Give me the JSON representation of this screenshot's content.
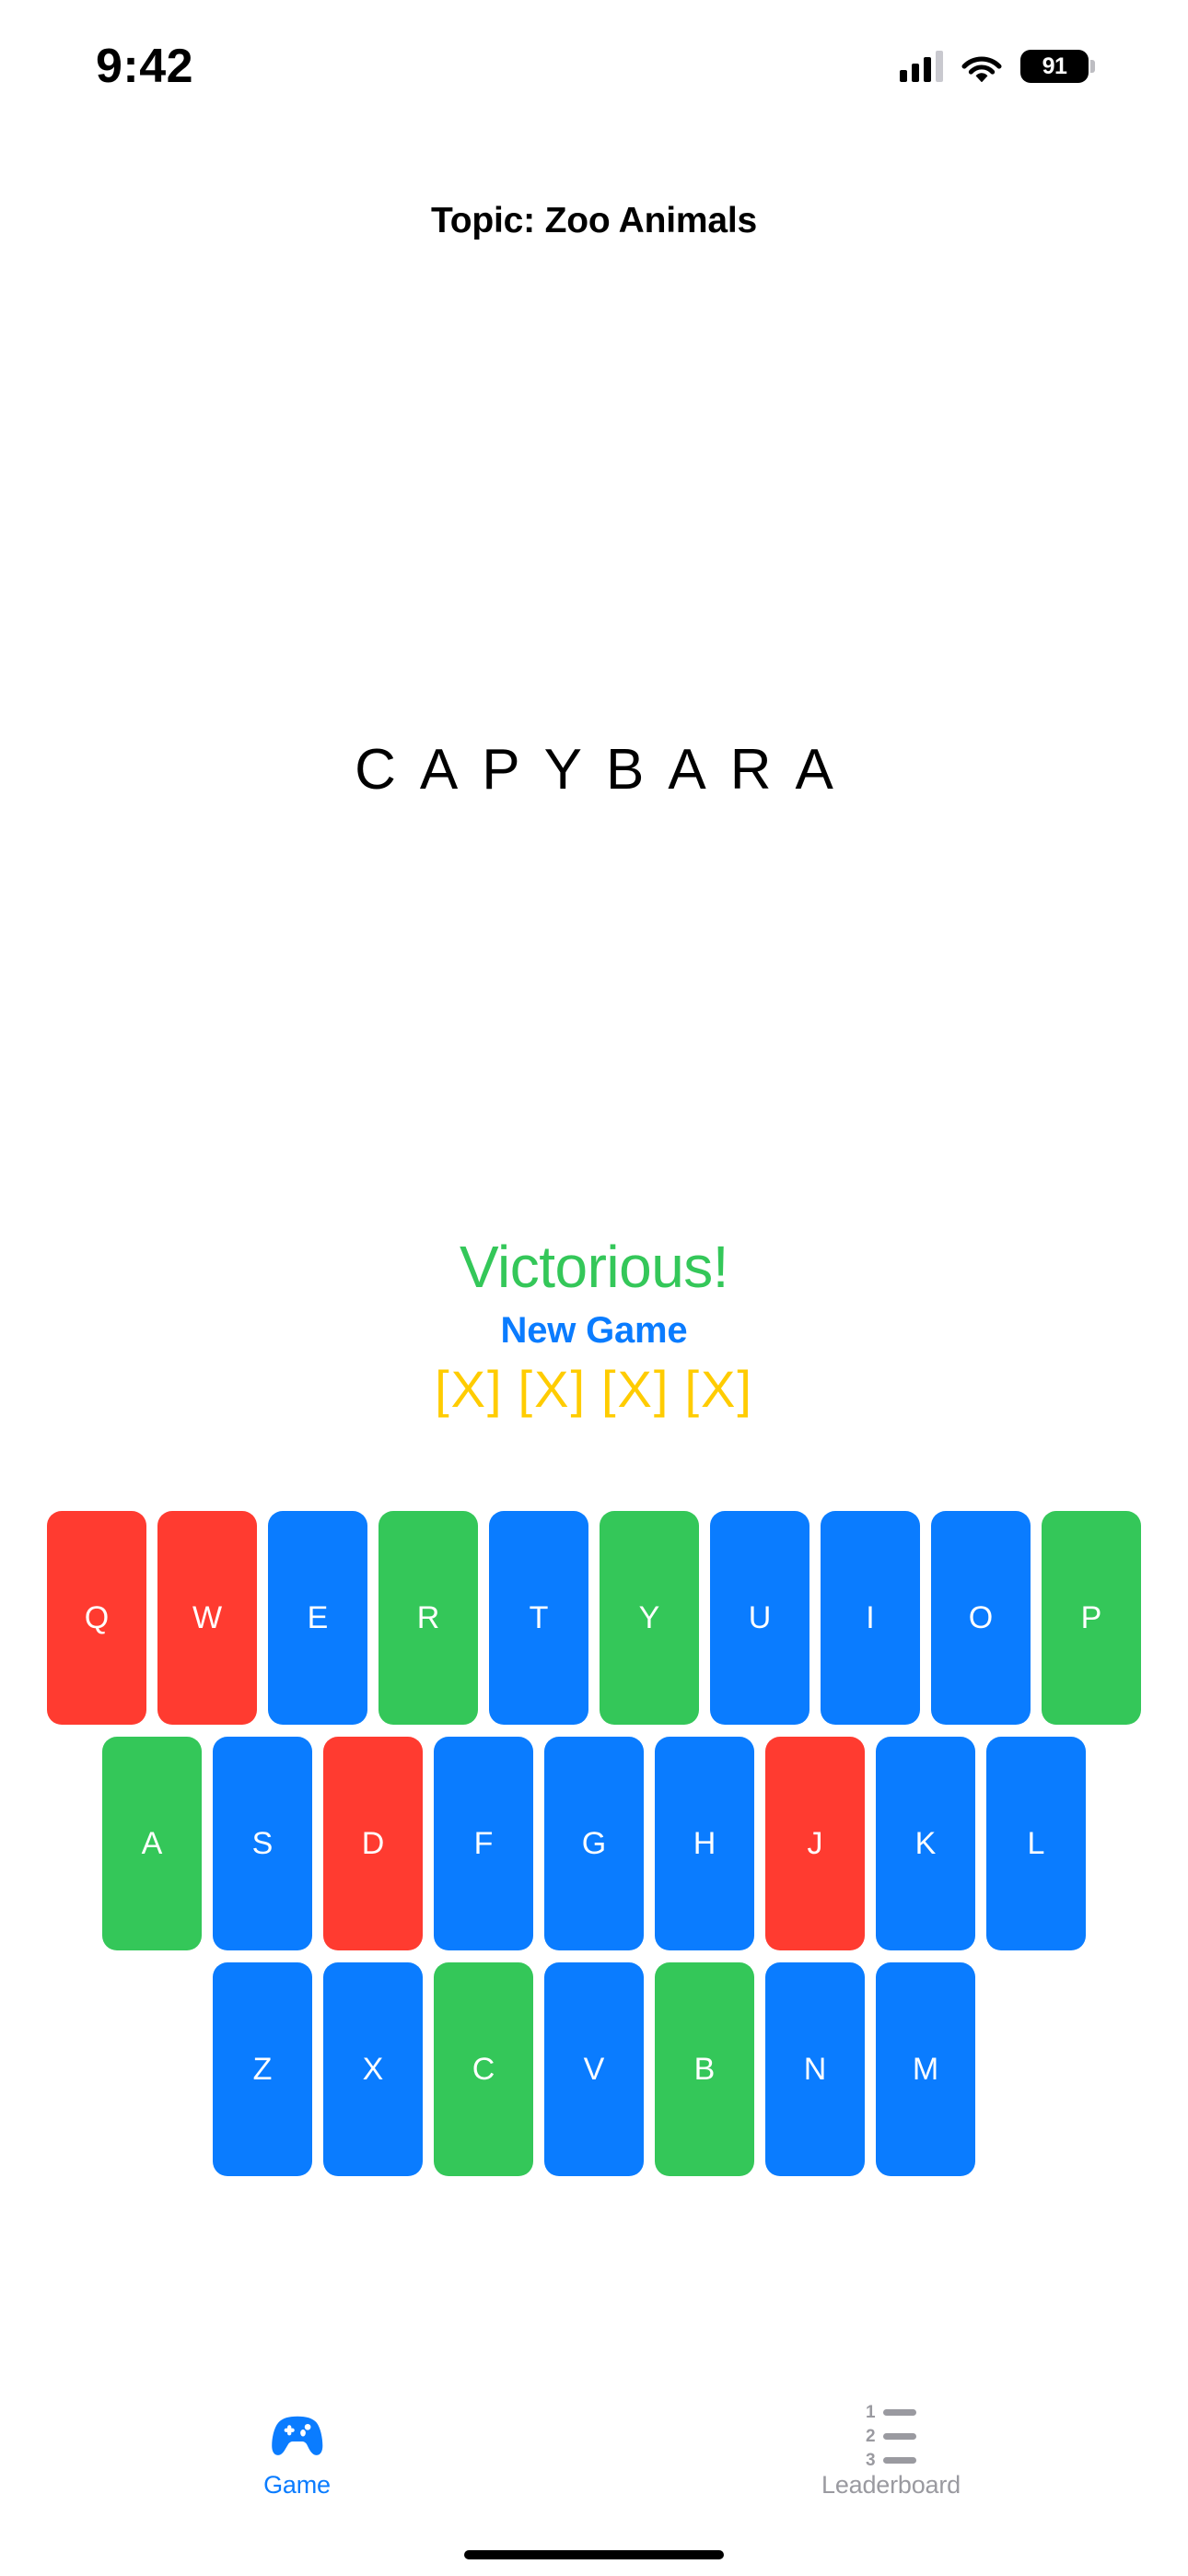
{
  "status_bar": {
    "time": "9:42",
    "cellular_icon": "cellular-signal-icon",
    "wifi_icon": "wifi-icon",
    "battery_icon": "battery-icon",
    "battery_level": "91"
  },
  "header": {
    "topic_label": "Topic: Zoo Animals"
  },
  "game": {
    "secret_word": "CAPYBARA",
    "status_text": "Victorious!",
    "status_color": "#34c759",
    "new_game_label": "New Game",
    "lives_remaining": 4,
    "life_glyph": "[X]",
    "life_color": "#ffcc00"
  },
  "keyboard": {
    "colors": {
      "unused": "#0a7cff",
      "correct": "#34c759",
      "wrong": "#ff3b30"
    },
    "rows": [
      [
        {
          "letter": "Q",
          "state": "wrong"
        },
        {
          "letter": "W",
          "state": "wrong"
        },
        {
          "letter": "E",
          "state": "unused"
        },
        {
          "letter": "R",
          "state": "correct"
        },
        {
          "letter": "T",
          "state": "unused"
        },
        {
          "letter": "Y",
          "state": "correct"
        },
        {
          "letter": "U",
          "state": "unused"
        },
        {
          "letter": "I",
          "state": "unused"
        },
        {
          "letter": "O",
          "state": "unused"
        },
        {
          "letter": "P",
          "state": "correct"
        }
      ],
      [
        {
          "letter": "A",
          "state": "correct"
        },
        {
          "letter": "S",
          "state": "unused"
        },
        {
          "letter": "D",
          "state": "wrong"
        },
        {
          "letter": "F",
          "state": "unused"
        },
        {
          "letter": "G",
          "state": "unused"
        },
        {
          "letter": "H",
          "state": "unused"
        },
        {
          "letter": "J",
          "state": "wrong"
        },
        {
          "letter": "K",
          "state": "unused"
        },
        {
          "letter": "L",
          "state": "unused"
        }
      ],
      [
        {
          "letter": "Z",
          "state": "unused"
        },
        {
          "letter": "X",
          "state": "unused"
        },
        {
          "letter": "C",
          "state": "correct"
        },
        {
          "letter": "V",
          "state": "unused"
        },
        {
          "letter": "B",
          "state": "correct"
        },
        {
          "letter": "N",
          "state": "unused"
        },
        {
          "letter": "M",
          "state": "unused"
        }
      ]
    ]
  },
  "tab_bar": {
    "tabs": [
      {
        "label": "Game",
        "icon": "gamepad-icon",
        "active": true
      },
      {
        "label": "Leaderboard",
        "icon": "numbered-list-icon",
        "active": false
      }
    ],
    "active_color": "#0a7cff",
    "inactive_color": "#9a9aa0",
    "leaderboard_icon_numbers": [
      "1",
      "2",
      "3"
    ]
  }
}
